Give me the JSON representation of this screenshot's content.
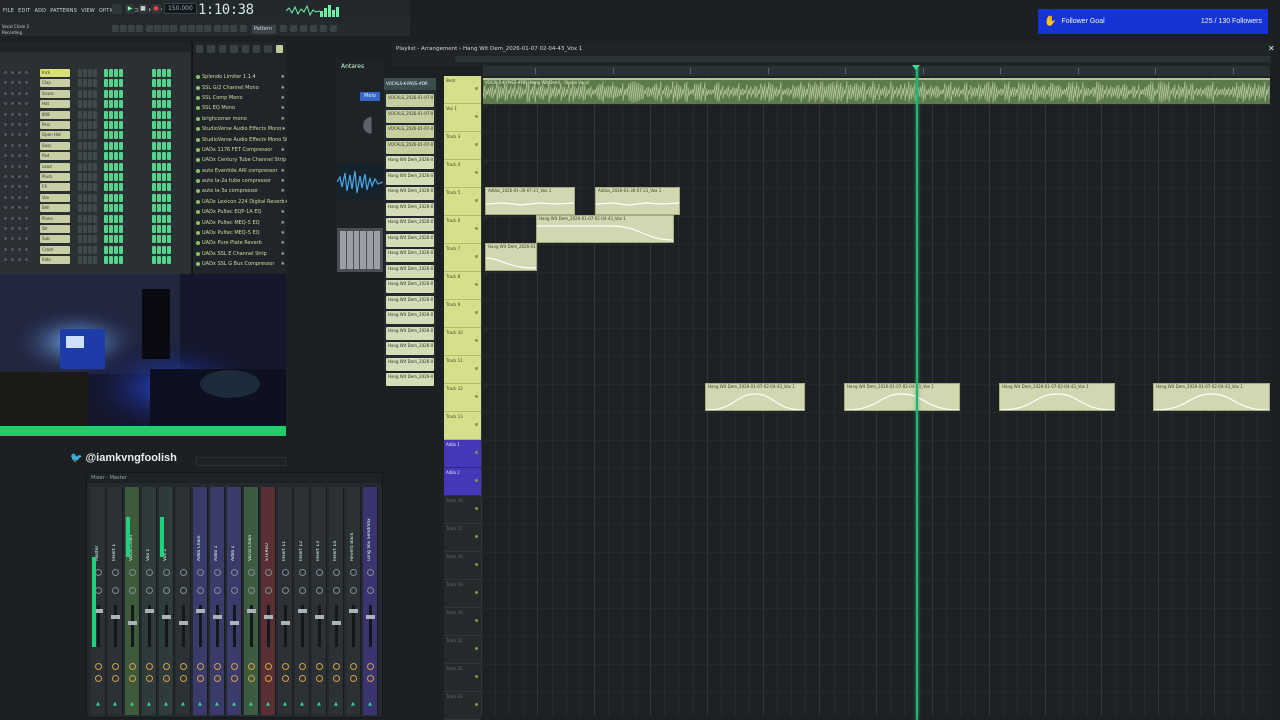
{
  "menu": [
    "FILE",
    "EDIT",
    "ADD",
    "PATTERNS",
    "VIEW",
    "OPTIONS",
    "TOOLS",
    "HELP"
  ],
  "transport": {
    "bpm": "150.000",
    "clock": "1:10:38"
  },
  "hint_text": "Whats new in FL Studio.net",
  "seq_info": [
    "Vocal Chain 2",
    "Recording"
  ],
  "toolbar": {
    "pattern": "Pattern"
  },
  "channel_rack": {
    "rows": [
      {
        "label": "Kick"
      },
      {
        "label": "Clap"
      },
      {
        "label": "Snare"
      },
      {
        "label": "Hat"
      },
      {
        "label": "808"
      },
      {
        "label": "Perc"
      },
      {
        "label": "Open Hat"
      },
      {
        "label": "Bass"
      },
      {
        "label": "Pad"
      },
      {
        "label": "Lead"
      },
      {
        "label": "Pluck"
      },
      {
        "label": "FX"
      },
      {
        "label": "Vox"
      },
      {
        "label": "Bell"
      },
      {
        "label": "Piano"
      },
      {
        "label": "Str"
      },
      {
        "label": "Sub"
      },
      {
        "label": "Crash"
      },
      {
        "label": "Ride"
      }
    ]
  },
  "plugins": [
    "Splendo Limiter 1.1.4",
    "SSL G/2 Channel Mono",
    "SSL Comp Mono",
    "SSL EQ Mono",
    "brighcorner mono",
    "StudioVerse Audio Effects Mono",
    "StudioVerse Audio Effects Mono Stereo",
    "UADx 1176 FET Compressor",
    "UADx Century Tube Channel Strip",
    "auto Eventide ARI compressor",
    "auto la-2a tube compressor",
    "auto la-3a compressor",
    "UADx Lexicon 224 Digital Reverb",
    "UADx Pultec EQP-1A EQ",
    "UADx Pultec MEQ-5 EQ",
    "UADx Pultec MEQ-5 EQ",
    "UADx Pure Plate Reverb",
    "UADx SSL E Channel Strip",
    "UADx SSL G Bus Compressor"
  ],
  "browser": {
    "tab": "Antares",
    "badge": "Melo"
  },
  "clip_list_header": "VOCALS-K-PASS-#DR",
  "clip_list": [
    "VOCALS_2026-01-07-0",
    "VOCALS_2026-01-07-0",
    "VOCALS_2026-01-07-0",
    "VOCALS_2026-01-07-0",
    "Hang Wit Dem_2026-01",
    "Hang Wit Dem_2026-01",
    "Hang Wit Dem_2026-01",
    "Hang Wit Dem_2026-01",
    "Hang Wit Dem_2026-01",
    "Hang Wit Dem_2026-01",
    "Hang Wit Dem_2026-01",
    "Hang Wit Dem_2026-01",
    "Hang Wit Dem_2026-01",
    "Hang Wit Dem_2026-01",
    "Hang Wit Dem_2026-01",
    "Hang Wit Dem_2026-01",
    "Hang Wit Dem_2026-01",
    "Hang Wit Dem_2026-01",
    "Hang Wit Dem_2026-01"
  ],
  "playlist": {
    "title": "Playlist - Arrangement › Hang Wit Dem_2026-01-07 02-04-43_Vox 1",
    "main_clip": "VOCALS-K-PASS-#DR (Hang Wit Dem) - Studio Vocal",
    "track_headers": [
      {
        "label": "Beat",
        "style": "y",
        "h": 28
      },
      {
        "label": "Vox 1",
        "style": "y",
        "h": 28
      },
      {
        "label": "Track 3",
        "style": "y",
        "h": 28
      },
      {
        "label": "Track 4",
        "style": "y",
        "h": 28
      },
      {
        "label": "Track 5",
        "style": "y",
        "h": 28
      },
      {
        "label": "Track 6",
        "style": "y",
        "h": 28
      },
      {
        "label": "Track 7",
        "style": "y",
        "h": 28
      },
      {
        "label": "Track 8",
        "style": "y",
        "h": 28
      },
      {
        "label": "Track 9",
        "style": "y",
        "h": 28
      },
      {
        "label": "Track 10",
        "style": "y",
        "h": 28
      },
      {
        "label": "Track 11",
        "style": "y",
        "h": 28
      },
      {
        "label": "Track 12",
        "style": "y",
        "h": 28
      },
      {
        "label": "Track 13",
        "style": "y",
        "h": 28
      },
      {
        "label": "Adlib 1",
        "style": "p",
        "h": 28
      },
      {
        "label": "Adlib 2",
        "style": "p",
        "h": 28
      },
      {
        "label": "Track 16",
        "style": "g",
        "h": 28
      },
      {
        "label": "Track 17",
        "style": "g",
        "h": 28
      },
      {
        "label": "Track 18",
        "style": "g",
        "h": 28
      },
      {
        "label": "Track 19",
        "style": "g",
        "h": 28
      },
      {
        "label": "Track 20",
        "style": "g",
        "h": 28
      },
      {
        "label": "Track 21",
        "style": "g",
        "h": 28
      },
      {
        "label": "Track 22",
        "style": "g",
        "h": 28
      },
      {
        "label": "Track 23",
        "style": "g",
        "h": 28
      }
    ],
    "clips": [
      {
        "label": "Adlibs_2026-01-30-07-21_Vox 1"
      },
      {
        "label": "Adlibs_2026-01-30-07-21_Vox 1"
      },
      {
        "label": "Hang Wit Dem_2026-01-07-02-04-43_Vox 1"
      },
      {
        "label": "Hang Wit Dem_2026-01-07"
      },
      {
        "label": "Hang Wit Dem_2026-01-07-02-04-43_Vox 1"
      },
      {
        "label": "Hang Wit Dem_2026-01-07-02-04-43_Vox 1"
      },
      {
        "label": "Hang Wit Dem_2026-01-07-02-04-43_Vox 1"
      },
      {
        "label": "Hang Wit Dem_2026-01-07-02-04-43_Vox 1"
      }
    ]
  },
  "stream": {
    "twitter_handle": "@iamkvngfoolish",
    "goal_label": "Follower Goal",
    "goal_count": "125 / 130 Followers"
  },
  "mixer": {
    "title": "Mixer - Master",
    "strips": [
      "Master",
      "Insert 1",
      "Vocal Chain",
      "Vox 1",
      "Vox 2",
      "",
      "Adlib Chain",
      "Adlib 1",
      "Adlib 2",
      "Vocal Chain",
      "STEREO",
      "Insert 11",
      "Insert 12",
      "Insert 13",
      "Insert 14",
      "Reverb Back",
      "Long Vox Send/Vox"
    ],
    "strip_colors": [
      "#2b3134",
      "#2b3134",
      "#3f5a3b",
      "#2f3a3b",
      "#2f3a3b",
      "#2b3134",
      "#3a3b6a",
      "#3a3b6a",
      "#3a3b6a",
      "#3e5a3f",
      "#5a2f33",
      "#2b3134",
      "#2b3134",
      "#2b3134",
      "#2b3134",
      "#2b3134",
      "#3a3470"
    ]
  }
}
